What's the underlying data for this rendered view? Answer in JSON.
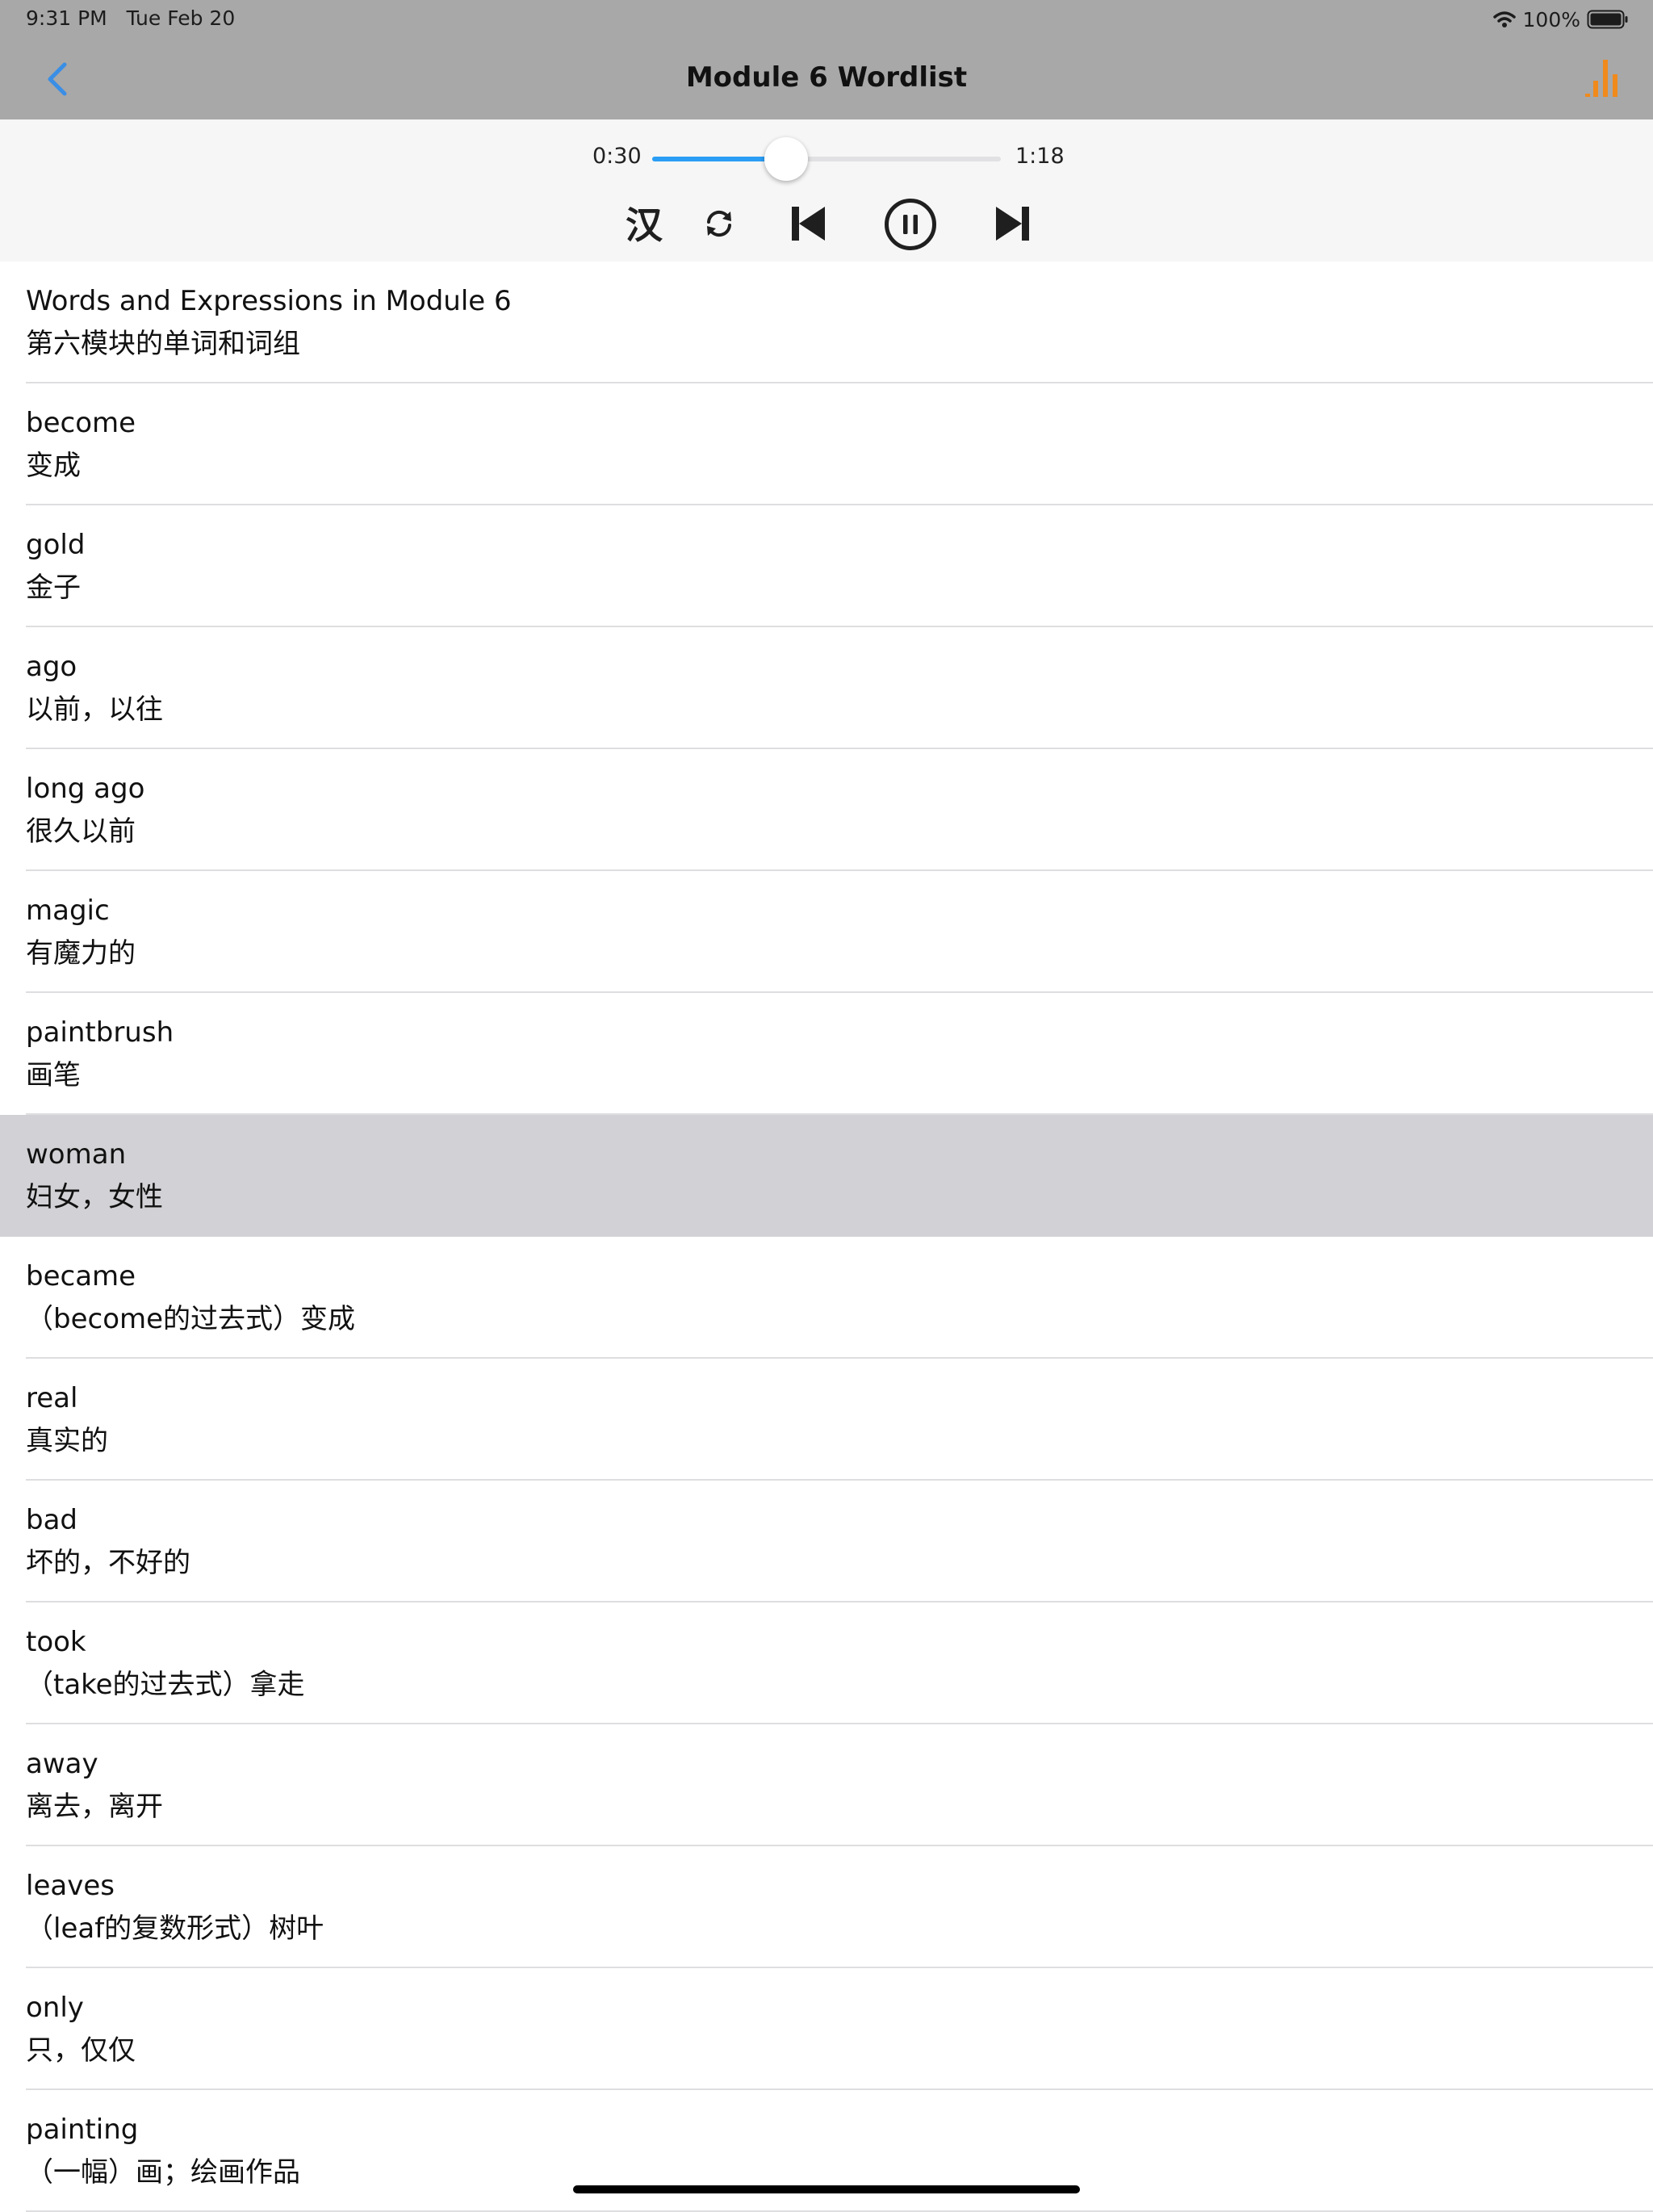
{
  "status_bar": {
    "time": "9:31 PM",
    "date": "Tue Feb 20",
    "battery": "100%"
  },
  "nav": {
    "title": "Module 6  Wordlist"
  },
  "player": {
    "elapsed": "0:30",
    "duration": "1:18",
    "progress_fraction": 0.385,
    "chinese_toggle_label": "汉",
    "accent_color": "#2a9df4"
  },
  "colors": {
    "nav_background": "#a8a8a8",
    "back_icon": "#3a8ee6",
    "stats_icon": "#f08a1c",
    "selected_row": "#d2d2d6"
  },
  "words": [
    {
      "en": "Words and Expressions in Module 6",
      "zh": "第六模块的单词和词组"
    },
    {
      "en": "become",
      "zh": "变成"
    },
    {
      "en": "gold",
      "zh": "金子"
    },
    {
      "en": "ago",
      "zh": "以前，以往"
    },
    {
      "en": "long ago",
      "zh": "很久以前"
    },
    {
      "en": "magic",
      "zh": "有魔力的"
    },
    {
      "en": "paintbrush",
      "zh": "画笔"
    },
    {
      "en": "woman",
      "zh": "妇女，女性",
      "selected": true
    },
    {
      "en": "became",
      "zh": "（become的过去式）变成"
    },
    {
      "en": "real",
      "zh": "真实的"
    },
    {
      "en": "bad",
      "zh": "坏的，不好的"
    },
    {
      "en": "took",
      "zh": "（take的过去式）拿走"
    },
    {
      "en": "away",
      "zh": "离去，离开"
    },
    {
      "en": "leaves",
      "zh": "（leaf的复数形式）树叶"
    },
    {
      "en": "only",
      "zh": "只，仅仅"
    },
    {
      "en": "painting",
      "zh": "（一幅）画；绘画作品"
    }
  ]
}
